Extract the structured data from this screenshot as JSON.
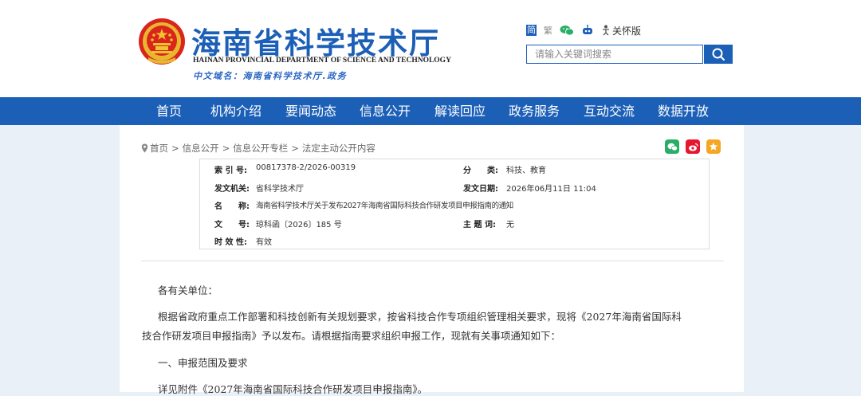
{
  "header": {
    "title": "海南省科学技术厅",
    "title_en": "HAINAN PROVINCIAL DEPARTMENT OF SCIENCE AND TECHNOLOGY",
    "domain_line": "中文域名：海南省科学技术厅.政务",
    "top_links": {
      "simplified": "简",
      "traditional": "繁",
      "elder": "关怀版"
    },
    "search_placeholder": "请输入关键词搜索"
  },
  "nav": {
    "items": [
      "首页",
      "机构介绍",
      "要闻动态",
      "信息公开",
      "解读回应",
      "政务服务",
      "互动交流",
      "数据开放"
    ]
  },
  "breadcrumb": [
    "首页",
    "信息公开",
    "信息公开专栏",
    "法定主动公开内容"
  ],
  "meta": {
    "index_label": "索 引 号:",
    "index_value": "00817378-2/2026-00319",
    "category_label": "分　　类:",
    "category_value": "科技、教育",
    "issuer_label": "发文机关:",
    "issuer_value": "省科学技术厅",
    "date_label": "发文日期:",
    "date_value": "2026年06月11日 11:04",
    "name_label": "名　　称:",
    "name_value": "海南省科学技术厅关于发布2027年海南省国际科技合作研发项目申报指南的通知",
    "docno_label": "文　　号:",
    "docno_value": "琼科函〔2026〕185 号",
    "subject_label": "主 题 词:",
    "subject_value": "无",
    "validity_label": "时 效 性:",
    "validity_value": "有效"
  },
  "body": {
    "salutation": "各有关单位：",
    "para1_line1": "根据省政府重点工作部署和科技创新有关规划要求，按省科技合作专项组织管理相关要求，现将《2027年海南省国际科",
    "para1_line2": "技合作研发项目申报指南》予以发布。请根据指南要求组织申报工作，现就有关事项通知如下：",
    "section1": "一、申报范围及要求",
    "para2": "详见附件《2027年海南省国际科技合作研发项目申报指南》。"
  },
  "colors": {
    "brand_blue": "#1c5fb7",
    "wechat_green": "#2aae67",
    "weibo_red": "#e6162d",
    "fav_orange": "#f5a623"
  }
}
